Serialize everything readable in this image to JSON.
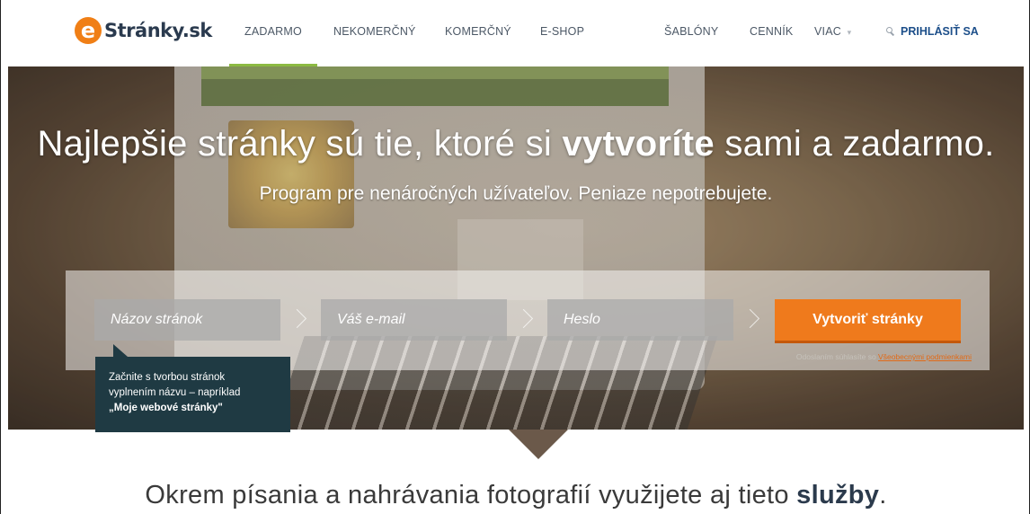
{
  "brand": {
    "logo_letter": "e",
    "name": "Stránky.sk",
    "accent": "#ef7a1c",
    "nav_active_color": "#8cba42"
  },
  "nav": {
    "items": [
      "ZADARMO",
      "NEKOMERČNÝ",
      "KOMERČNÝ",
      "E-SHOP",
      "ŠABLÓNY",
      "CENNÍK",
      "VIAC"
    ],
    "more_caret": "▾",
    "active": "ZADARMO",
    "login_label": "PRIHLÁSIŤ SA",
    "login_icon": "key-icon"
  },
  "hero": {
    "title_light_1": "Najlepšie stránky sú tie, ktoré si ",
    "title_bold": "vytvoríte",
    "title_light_2": " sami a zadarmo.",
    "subtitle": "Program pre nenáročných užívateľov. Peniaze nepotrebujete."
  },
  "form": {
    "name_placeholder": "Názov stránok",
    "email_placeholder": "Váš e-mail",
    "password_placeholder": "Heslo",
    "submit_label": "Vytvoriť stránky",
    "terms_prefix": "Odoslaním súhlasíte so ",
    "terms_link": "Všeobecnými podmienkami"
  },
  "tooltip": {
    "line1": "Začnite s tvorbou stránok",
    "line2": "vyplnením názvu – napríklad",
    "example": "„Moje webové stránky\""
  },
  "services": {
    "text_light": "Okrem písania a nahrávania fotografií využijete aj tieto ",
    "text_bold": "služby",
    "text_end": "."
  }
}
